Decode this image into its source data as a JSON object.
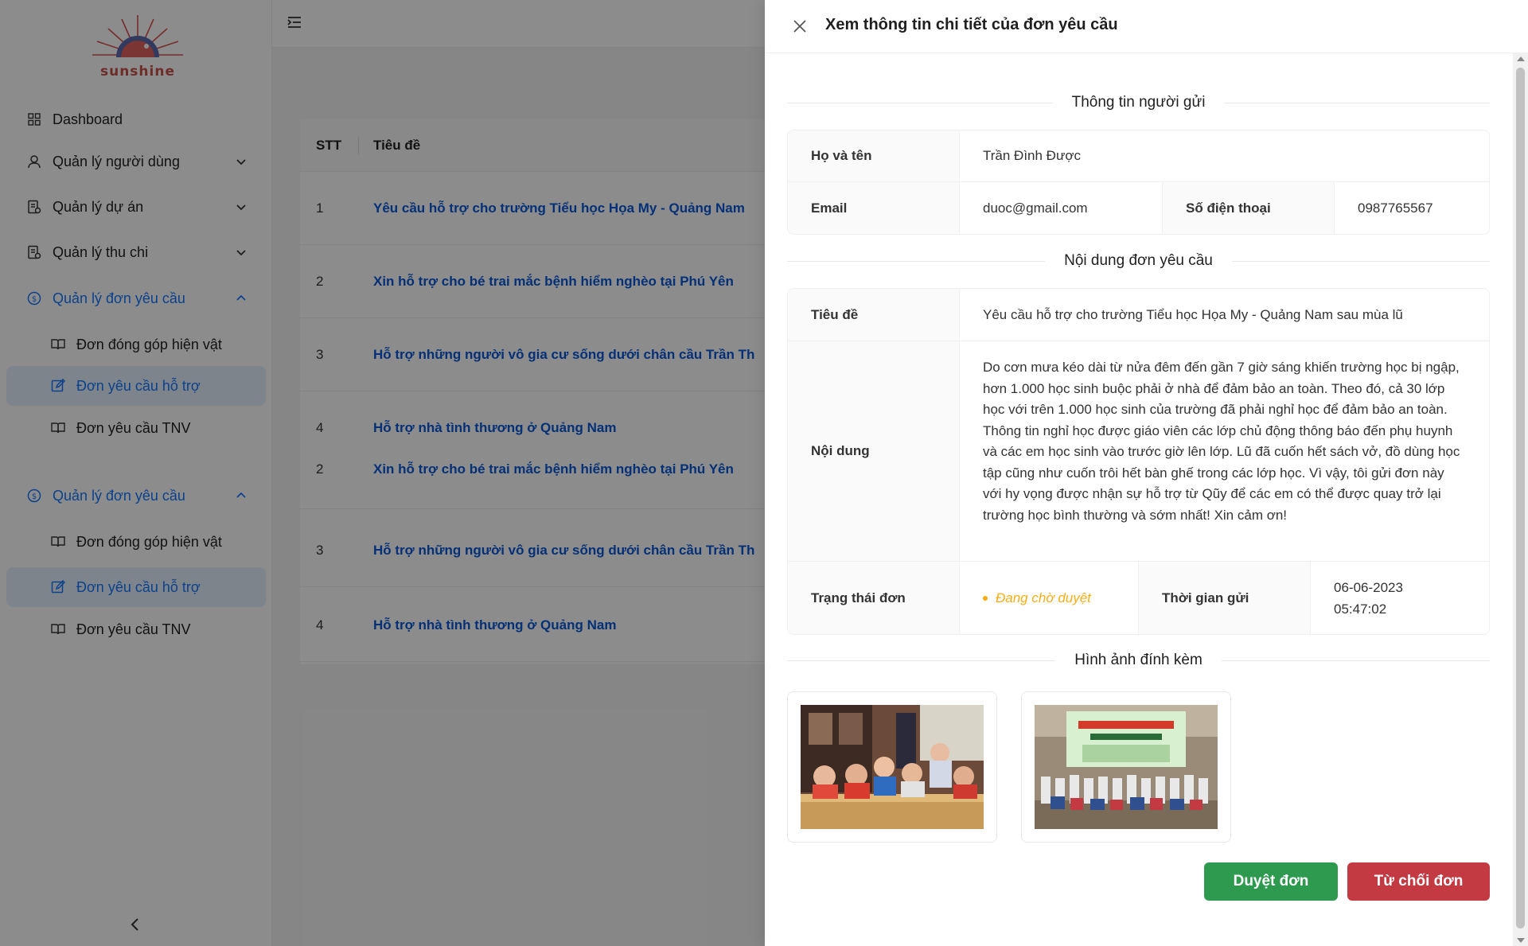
{
  "sidebar": {
    "logo_text": "sunshine",
    "items": [
      {
        "label": "Dashboard"
      },
      {
        "label": "Quản lý người dùng"
      },
      {
        "label": "Quản lý dự án"
      },
      {
        "label": "Quản lý thu chi"
      },
      {
        "label": "Quản lý đơn yêu cầu"
      },
      {
        "label": "Đơn đóng góp hiện vật"
      },
      {
        "label": "Đơn yêu cầu hỗ trợ"
      },
      {
        "label": "Đơn yêu cầu TNV"
      },
      {
        "label": "Quản lý đơn yêu cầu"
      },
      {
        "label": "Đơn đóng góp hiện vật"
      },
      {
        "label": "Đơn yêu cầu hỗ trợ"
      },
      {
        "label": "Đơn yêu cầu TNV"
      }
    ]
  },
  "table": {
    "columns": [
      "STT",
      "Tiêu đề"
    ],
    "rows": [
      {
        "stt": "1",
        "title": "Yêu cầu hỗ trợ cho trường Tiểu học Họa My - Quảng Nam"
      },
      {
        "stt": "2",
        "title": "Xin hỗ trợ cho bé trai mắc bệnh hiểm nghèo tại Phú Yên"
      },
      {
        "stt": "3",
        "title": "Hỗ trợ những người vô gia cư sống dưới chân cầu Trần Th"
      },
      {
        "stt": "4",
        "title": "Hỗ trợ nhà tình thương ở Quảng Nam"
      },
      {
        "stt": "2",
        "title": "Xin hỗ trợ cho bé trai mắc bệnh hiểm nghèo tại Phú Yên"
      },
      {
        "stt": "3",
        "title": "Hỗ trợ những người vô gia cư sống dưới chân cầu Trần Th"
      },
      {
        "stt": "4",
        "title": "Hỗ trợ nhà tình thương ở Quảng Nam"
      }
    ]
  },
  "drawer": {
    "title": "Xem thông tin chi tiết của đơn yêu cầu",
    "sender_section": "Thông tin người gửi",
    "sender": {
      "name_label": "Họ và tên",
      "name": "Trần Đình Được",
      "email_label": "Email",
      "email": "duoc@gmail.com",
      "phone_label": "Số điện thoại",
      "phone": "0987765567"
    },
    "content_section": "Nội dung đơn yêu cầu",
    "request": {
      "title_label": "Tiêu đề",
      "title": "Yêu cầu hỗ trợ cho trường Tiểu học Họa My - Quảng Nam sau mùa lũ",
      "content_label": "Nội dung",
      "content": "Do cơn mưa kéo dài từ nửa đêm đến gần 7 giờ sáng khiến trường học bị ngập, hơn 1.000 học sinh buộc phải ở nhà để đảm bảo an toàn. Theo đó, cả 30 lớp học với trên 1.000 học sinh của trường đã phải nghỉ học để đảm bảo an toàn. Thông tin nghỉ học được giáo viên các lớp chủ động thông báo đến phụ huynh và các em học sinh vào trước giờ lên lớp. Lũ đã cuốn hết sách vở, đồ dùng học tập cũng như cuốn trôi hết bàn ghế trong các lớp học. Vì vậy, tôi gửi đơn này với hy vọng được nhận sự hỗ trợ từ Qũy để các em có thể được quay trở lại trường học bình thường và sớm nhất! Xin cảm ơn!",
      "status_label": "Trạng thái đơn",
      "status": "Đang chờ duyệt",
      "status_color": "#faad14",
      "time_label": "Thời gian gửi",
      "date": "06-06-2023",
      "time": "05:47:02"
    },
    "images_section": "Hình ảnh đính kèm",
    "buttons": {
      "approve": "Duyệt đơn",
      "reject": "Từ chối đơn"
    }
  },
  "colors": {
    "primary": "#1677ff",
    "approve": "#2e9a4f",
    "reject": "#c33a43",
    "pending": "#faad14"
  }
}
